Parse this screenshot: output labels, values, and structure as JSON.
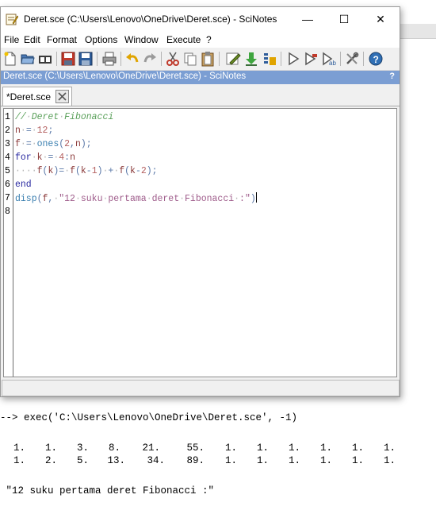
{
  "window": {
    "title": "Deret.sce (C:\\Users\\Lenovo\\OneDrive\\Deret.sce) - SciNotes",
    "minimize_glyph": "—",
    "maximize_glyph": "☐",
    "close_glyph": "✕"
  },
  "menu": [
    "File",
    "Edit",
    "Format",
    "Options",
    "Window",
    "Execute",
    "?"
  ],
  "toolbar_icons": [
    "new-file-icon",
    "open-file-icon",
    "open-recent-icon",
    "save-icon",
    "save-as-icon",
    "print-icon",
    "undo-icon",
    "redo-icon",
    "cut-icon",
    "copy-icon",
    "paste-icon",
    "indent-icon",
    "execute-download-icon",
    "execute-file-icon",
    "run-icon",
    "run-selection-icon",
    "run-to-cursor-icon",
    "preferences-icon",
    "help-icon"
  ],
  "panel": {
    "title": "Deret.sce (C:\\Users\\Lenovo\\OneDrive\\Deret.sce) - SciNotes",
    "help": "?"
  },
  "tab": {
    "label": "*Deret.sce"
  },
  "editor": {
    "line_numbers": [
      "1",
      "2",
      "3",
      "4",
      "5",
      "6",
      "7",
      "8"
    ],
    "lines": [
      "// Deret Fibonacci",
      "n = 12;",
      "f = ones(2,n);",
      "for k = 4:n",
      "    f(k)= f(k-1) + f(k-2);",
      "end",
      "disp(f, \"12 suku pertama deret Fibonacci :\")",
      ""
    ]
  },
  "console": {
    "command": "--> exec('C:\\Users\\Lenovo\\OneDrive\\Deret.sce', -1)",
    "row1": [
      "1.",
      "1.",
      "3.",
      "8.",
      "21.",
      "55.",
      "1.",
      "1.",
      "1.",
      "1.",
      "1.",
      "1."
    ],
    "row2": [
      "1.",
      "2.",
      "5.",
      "13.",
      "34.",
      "89.",
      "1.",
      "1.",
      "1.",
      "1.",
      "1.",
      "1."
    ],
    "message": " \"12 suku pertama deret Fibonacci :\""
  }
}
